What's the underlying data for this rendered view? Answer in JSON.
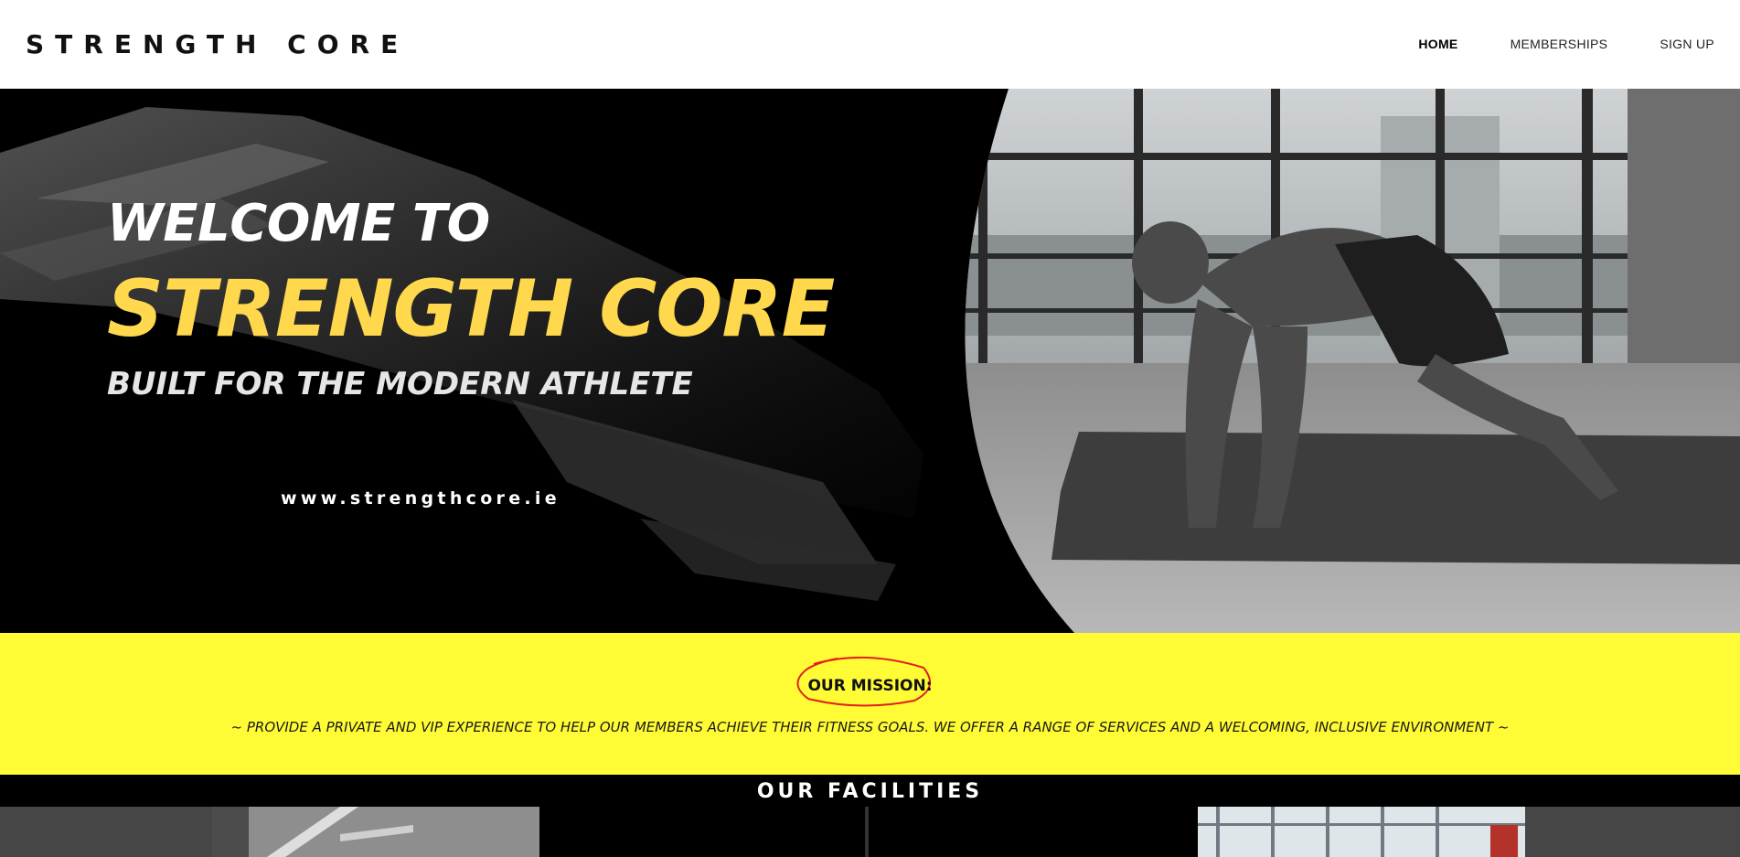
{
  "header": {
    "brand": "STRENGTH CORE",
    "nav": {
      "home": "HOME",
      "memberships": "MEMBERSHIPS",
      "signup": "SIGN UP"
    }
  },
  "hero": {
    "welcome": "WELCOME TO",
    "headline": "STRENGTH CORE",
    "tagline": "BUILT FOR THE MODERN ATHLETE",
    "url": "www.strengthcore.ie"
  },
  "mission": {
    "title": "OUR MISSION:",
    "text": "~ PROVIDE A PRIVATE AND VIP EXPERIENCE TO HELP OUR MEMBERS ACHIEVE THEIR FITNESS GOALS. WE OFFER A RANGE OF SERVICES AND A WELCOMING, INCLUSIVE ENVIRONMENT ~"
  },
  "facilities": {
    "title": "OUR FACILITIES"
  },
  "colors": {
    "accent_yellow": "#fffb34",
    "headline_yellow": "#ffd84d",
    "annotation_red": "#e0201c"
  }
}
